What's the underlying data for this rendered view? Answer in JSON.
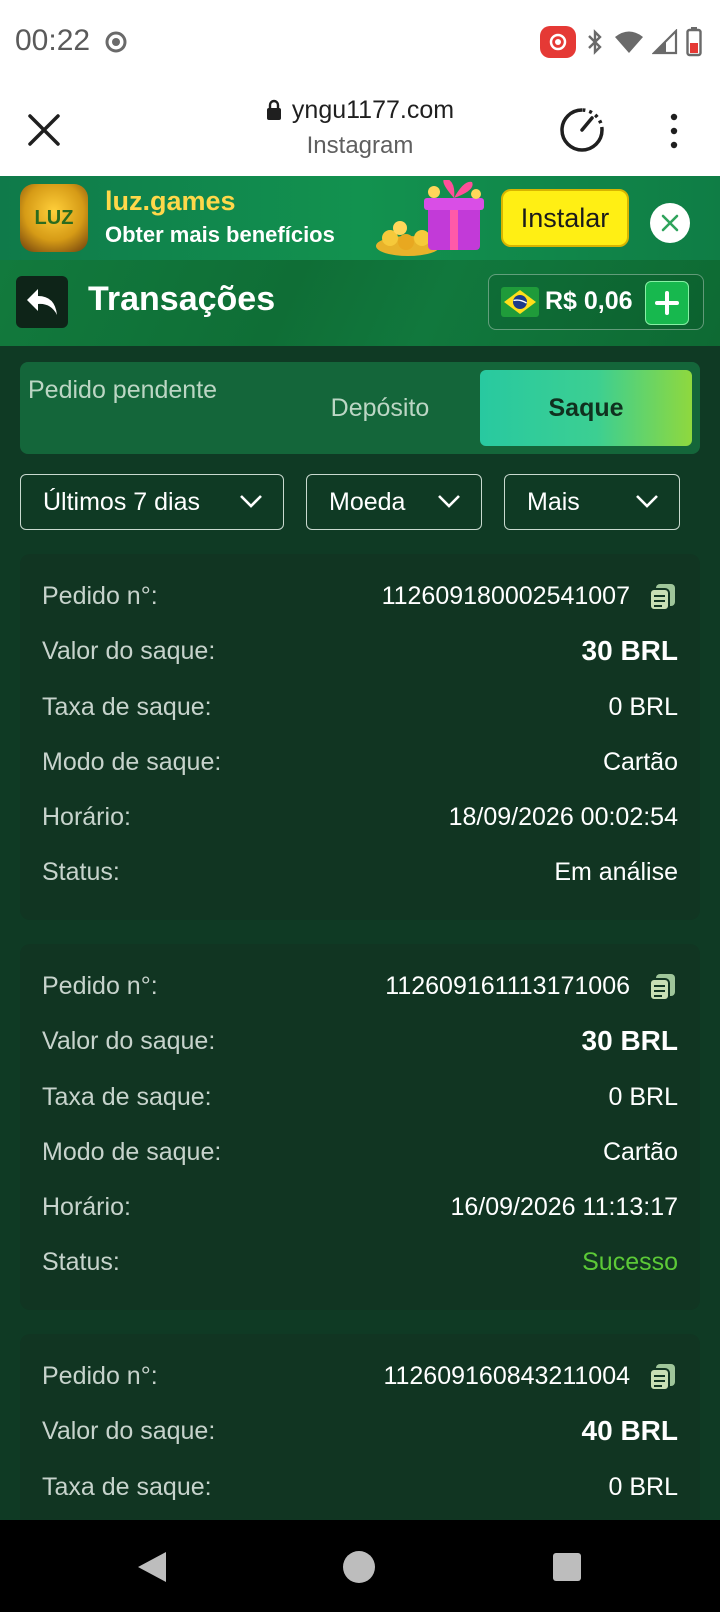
{
  "status_bar": {
    "time": "00:22"
  },
  "browser": {
    "url": "yngu1177.com",
    "subtitle": "Instagram"
  },
  "promo": {
    "title": "luz.games",
    "subtitle": "Obter mais benefícios",
    "install_label": "Instalar",
    "logo_text": "LUZ"
  },
  "header": {
    "title": "Transações",
    "balance": "R$ 0,06"
  },
  "tabs": {
    "pending": "Pedido pendente",
    "deposit": "Depósito",
    "withdraw": "Saque"
  },
  "filters": {
    "period": "Últimos 7 dias",
    "currency": "Moeda",
    "more": "Mais"
  },
  "labels": {
    "order": "Pedido n°:",
    "amount": "Valor do saque:",
    "fee": "Taxa de saque:",
    "mode": "Modo de saque:",
    "time": "Horário:",
    "status": "Status:"
  },
  "transactions": [
    {
      "order": "112609180002541007",
      "amount": "30 BRL",
      "fee": "0 BRL",
      "mode": "Cartão",
      "time": "18/09/2026 00:02:54",
      "status": "Em análise"
    },
    {
      "order": "112609161113171006",
      "amount": "30 BRL",
      "fee": "0 BRL",
      "mode": "Cartão",
      "time": "16/09/2026 11:13:17",
      "status": "Sucesso"
    },
    {
      "order": "112609160843211004",
      "amount": "40 BRL",
      "fee": "0 BRL"
    }
  ],
  "colors": {
    "background": "#0f3a24",
    "card": "#113522",
    "success": "#5cc937",
    "accent": "#28c9a0"
  }
}
